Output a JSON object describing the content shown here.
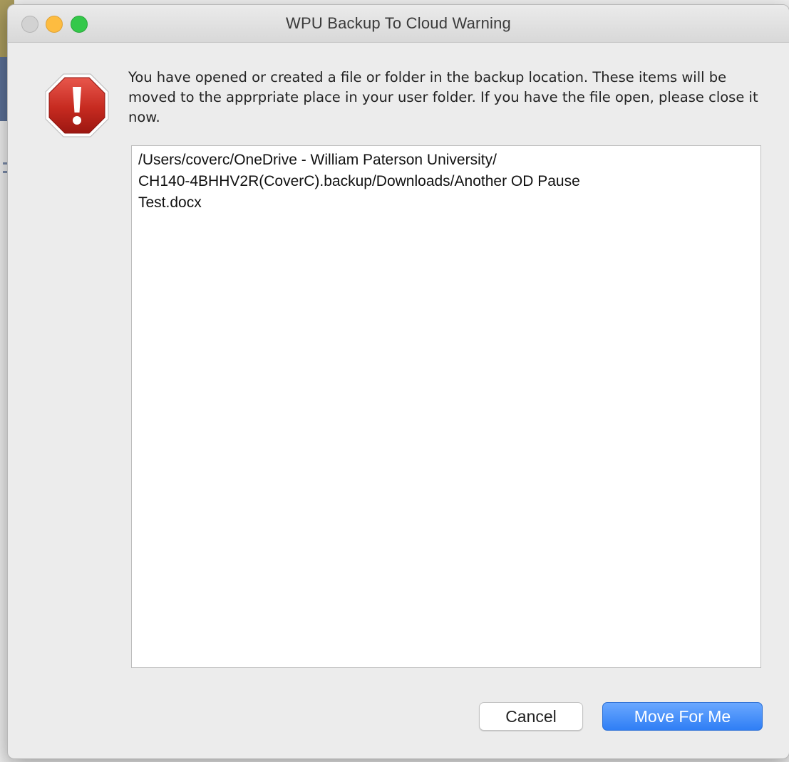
{
  "window": {
    "title": "WPU Backup To Cloud Warning"
  },
  "alert": {
    "icon": "stop-alert-exclamation-icon",
    "message": "You have opened or created a file or folder in the backup location. These items will be moved to the apprpriate place in your user folder. If you have the file open, please close it now."
  },
  "file_list": {
    "text": "/Users/coverc/OneDrive - William Paterson University/\nCH140-4BHHV2R(CoverC).backup/Downloads/Another OD Pause\nTest.docx"
  },
  "buttons": {
    "cancel_label": "Cancel",
    "primary_label": "Move For Me"
  },
  "colors": {
    "primary_button": "#2f7ef5",
    "alert_red": "#c0211a",
    "close_light": "#d2d2d2",
    "minimize_light": "#fdbc40",
    "zoom_light": "#34c84a"
  }
}
